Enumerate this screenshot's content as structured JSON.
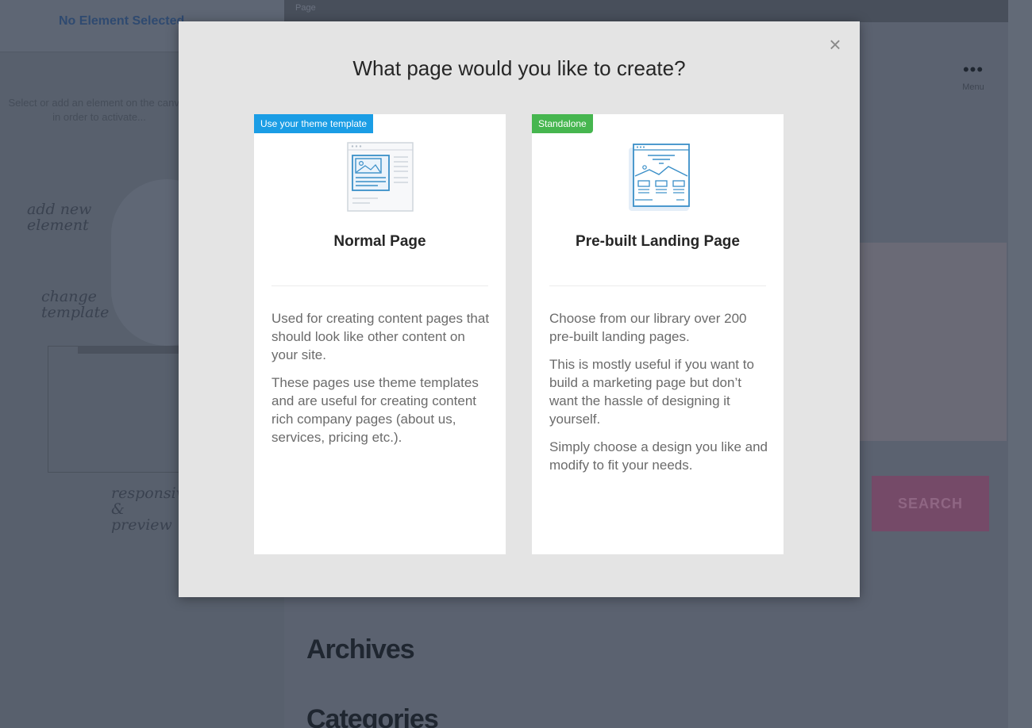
{
  "background": {
    "left_panel": {
      "title": "No Element Selected",
      "hint": "Select or add an element on the canvas in order to activate...",
      "annotations": [
        "add new element",
        "change template",
        "responsive & preview"
      ]
    },
    "top_bar_label": "Page",
    "menu": {
      "dots": "•••",
      "label": "Menu"
    },
    "search_button": "SEARCH",
    "widgets": [
      "Archives",
      "Categories"
    ]
  },
  "modal": {
    "title": "What page would you like to create?",
    "close_label": "×",
    "cards": [
      {
        "badge": "Use your theme template",
        "badge_color": "#1a9de5",
        "title": "Normal Page",
        "paragraphs": [
          "Used for creating content pages that should look like other content on your site.",
          "These pages use theme templates and are useful for creating content rich company pages (about us, services, pricing etc.)."
        ]
      },
      {
        "badge": "Standalone",
        "badge_color": "#46b64f",
        "title": "Pre-built Landing Page",
        "paragraphs": [
          "Choose from our library over 200 pre-built landing pages.",
          "This is mostly useful if you want to build a marketing page but don’t want the hassle of designing it yourself.",
          "Simply choose a design you like and modify to fit your needs."
        ]
      }
    ]
  },
  "colors": {
    "overlay": "#5b6270",
    "modal_bg": "#e4e4e4",
    "accent_blue": "#1a9de5",
    "accent_green": "#46b64f",
    "search_button": "#754a68"
  }
}
